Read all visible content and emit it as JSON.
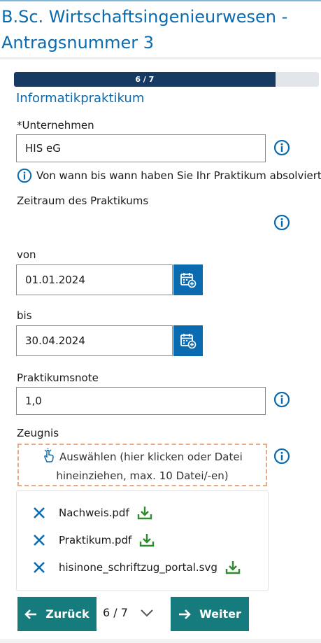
{
  "page": {
    "title_line1": "B.Sc. Wirtschaftsingenieurwesen -",
    "title_line2": "Antragsnummer 3"
  },
  "progress": {
    "label": "6 / 7",
    "fraction": 0.857
  },
  "section": {
    "title": "Informatikpraktikum"
  },
  "fields": {
    "company_label": "*Unternehmen",
    "company_value": "HIS eG",
    "period_hint": "Von wann bis wann haben Sie Ihr Praktikum absolviert?",
    "period_label": "Zeitraum des Praktikums",
    "from_label": "von",
    "from_value": "01.01.2024",
    "to_label": "bis",
    "to_value": "30.04.2024",
    "grade_label": "Praktikumsnote",
    "grade_value": "1,0",
    "certificate_label": "Zeugnis"
  },
  "upload": {
    "line1": "Auswählen (hier klicken oder Datei",
    "line2": "hineinziehen, max. 10 Datei/-en)"
  },
  "files": [
    {
      "name": "Nachweis.pdf"
    },
    {
      "name": "Praktikum.pdf"
    },
    {
      "name": "hisinone_schriftzug_portal.svg"
    }
  ],
  "navigation": {
    "back_label": "Zurück",
    "page_indicator": "6 / 7",
    "next_label": "Weiter"
  },
  "colors": {
    "primary": "#0a6bb0",
    "progress": "#173a63",
    "nav_button": "#167b7c",
    "download": "#2e8b2e",
    "remove": "#0a6bb0",
    "dropzone_border": "#e8a882"
  },
  "icons": [
    "info-icon",
    "calendar-add-icon",
    "hand-pointer-icon",
    "close-icon",
    "download-icon",
    "arrow-left-icon",
    "arrow-right-icon",
    "chevron-down-icon"
  ]
}
